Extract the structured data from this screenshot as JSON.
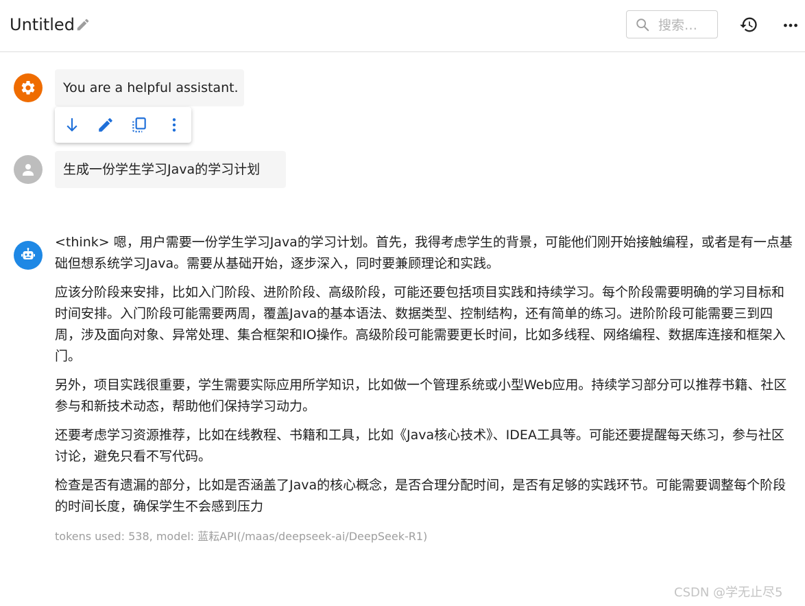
{
  "header": {
    "title": "Untitled",
    "search_placeholder": "搜索…"
  },
  "icons": {
    "edit_title": "pencil-icon",
    "search": "search-icon",
    "history": "history-icon",
    "more": "more-horizontal-icon",
    "system_avatar": "gear-icon",
    "user_avatar": "person-icon",
    "assistant_avatar": "robot-icon",
    "toolbar": [
      "arrow-down-icon",
      "pencil-icon",
      "copy-icon",
      "more-vertical-icon"
    ]
  },
  "colors": {
    "system_avatar": "#ef6c00",
    "user_avatar": "#bdbdbd",
    "assistant_avatar": "#1e88e5",
    "toolbar_icon": "#1e6fd9"
  },
  "messages": {
    "system": "You are a helpful assistant.",
    "user": "生成一份学生学习Java的学习计划",
    "assistant": [
      "<think> 嗯，用户需要一份学生学习Java的学习计划。首先，我得考虑学生的背景，可能他们刚开始接触编程，或者是有一点基础但想系统学习Java。需要从基础开始，逐步深入，同时要兼顾理论和实践。",
      "应该分阶段来安排，比如入门阶段、进阶阶段、高级阶段，可能还要包括项目实践和持续学习。每个阶段需要明确的学习目标和时间安排。入门阶段可能需要两周，覆盖Java的基本语法、数据类型、控制结构，还有简单的练习。进阶阶段可能需要三到四周，涉及面向对象、异常处理、集合框架和IO操作。高级阶段可能需要更长时间，比如多线程、网络编程、数据库连接和框架入门。",
      "另外，项目实践很重要，学生需要实际应用所学知识，比如做一个管理系统或小型Web应用。持续学习部分可以推荐书籍、社区参与和新技术动态，帮助他们保持学习动力。",
      "还要考虑学习资源推荐，比如在线教程、书籍和工具，比如《Java核心技术》、IDEA工具等。可能还要提醒每天练习，参与社区讨论，避免只看不写代码。",
      "检查是否有遗漏的部分，比如是否涵盖了Java的核心概念，是否合理分配时间，是否有足够的实践环节。可能需要调整每个阶段的时间长度，确保学生不会感到压力"
    ],
    "meta": "tokens used: 538, model: 蓝耘API(/maas/deepseek-ai/DeepSeek-R1)"
  },
  "watermark": "CSDN @学无止尽5"
}
